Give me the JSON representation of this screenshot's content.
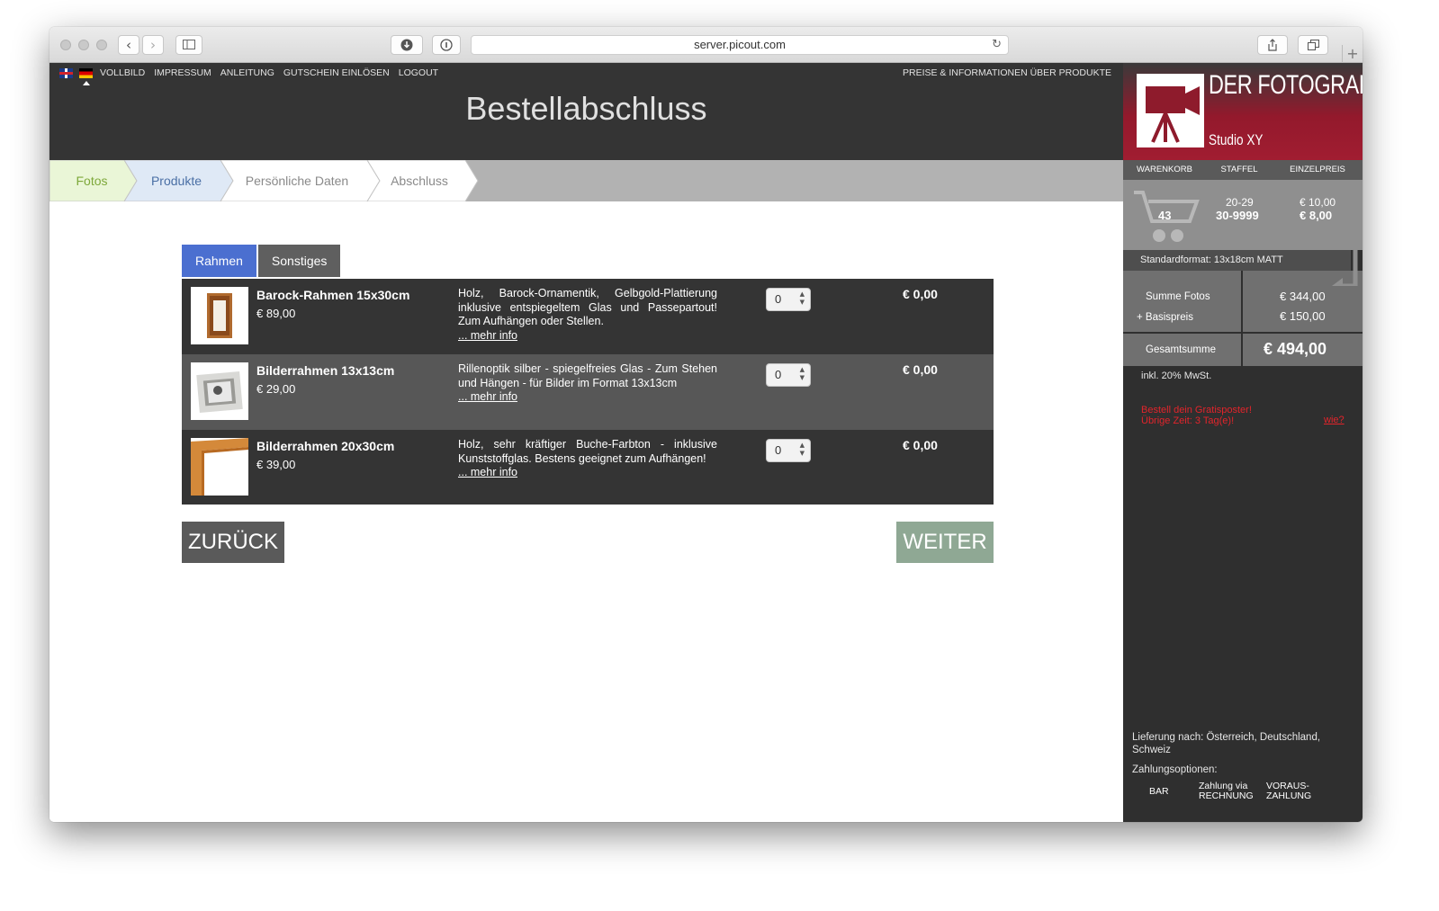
{
  "browser": {
    "url": "server.picout.com",
    "nav_back": "‹",
    "nav_forward": "›",
    "new_tab": "+"
  },
  "header": {
    "nav_items": [
      "VOLLBILD",
      "IMPRESSUM",
      "ANLEITUNG",
      "GUTSCHEIN EINLÖSEN",
      "LOGOUT"
    ],
    "prices_info": "PREISE & INFORMATIONEN ÜBER PRODUKTE",
    "title": "Bestellabschluss"
  },
  "steps": [
    {
      "label": "Fotos",
      "state": "done",
      "color": "#7ea83a",
      "bg": "#eaf6d7"
    },
    {
      "label": "Produkte",
      "state": "current",
      "color": "#4a6fa5",
      "bg": "#dfe9f6"
    },
    {
      "label": "Persönliche Daten",
      "state": "todo",
      "color": "#8a8a8a",
      "bg": "#ffffff"
    },
    {
      "label": "Abschluss",
      "state": "todo",
      "color": "#8a8a8a",
      "bg": "#ffffff"
    }
  ],
  "tabs": [
    {
      "label": "Rahmen",
      "active": true
    },
    {
      "label": "Sonstiges",
      "active": false
    }
  ],
  "products": [
    {
      "name": "Barock-Rahmen 15x30cm",
      "price": "€ 89,00",
      "description": "Holz, Barock-Ornamentik, Gelbgold-Plattierung inklusive entspiegeltem Glas und Passepartout! Zum Aufhängen oder Stellen.",
      "more_info": "... mehr info",
      "quantity": "0",
      "total": "€ 0,00"
    },
    {
      "name": "Bilderrahmen 13x13cm",
      "price": "€ 29,00",
      "description": "Rillenoptik silber - spiegelfreies Glas - Zum Stehen und Hängen - für Bilder im Format 13x13cm",
      "more_info": "... mehr info",
      "quantity": "0",
      "total": "€ 0,00"
    },
    {
      "name": "Bilderrahmen 20x30cm",
      "price": "€ 39,00",
      "description": "Holz, sehr kräftiger Buche-Farbton - inklusive Kunststoffglas. Bestens geeignet zum Aufhängen!",
      "more_info": "... mehr info",
      "quantity": "0",
      "total": "€ 0,00"
    }
  ],
  "buttons": {
    "back": "ZURÜCK",
    "next": "WEITER"
  },
  "sidebar": {
    "brand": "DER FOTOGRAF",
    "studio": "Studio XY",
    "col_headers": [
      "WARENKORB",
      "STAFFEL",
      "EINZELPREIS"
    ],
    "cart_count": "43",
    "tiers": [
      {
        "range": "20-29",
        "price": "€ 10,00"
      },
      {
        "range": "30-9999",
        "price": "€ 8,00"
      }
    ],
    "standard_format": "Standardformat: 13x18cm MATT",
    "sum_photos_label": "Summe Fotos",
    "sum_photos_value": "€ 344,00",
    "base_price_label": "+ Basispreis",
    "base_price_value": "€ 150,00",
    "total_label": "Gesamtsumme",
    "total_value": "€ 494,00",
    "vat_note": "inkl. 20% MwSt.",
    "promo_line1": "Bestell dein Gratisposter!",
    "promo_line2": "Übrige Zeit: 3 Tag(e)!",
    "promo_link": "wie?",
    "delivery": "Lieferung nach: Österreich, Deutschland, Schweiz",
    "payment_label": "Zahlungsoptionen:",
    "payment_options": [
      {
        "line1": "BAR",
        "line2": ""
      },
      {
        "line1": "Zahlung via",
        "line2": "RECHNUNG"
      },
      {
        "line1": "VORAUS-",
        "line2": "ZAHLUNG"
      }
    ]
  },
  "colors": {
    "header_bg": "#343434",
    "tab_active": "#4b6fd0",
    "next_button": "#8fa894",
    "brand_red": "#a11d31",
    "promo_red": "#e3242b"
  }
}
